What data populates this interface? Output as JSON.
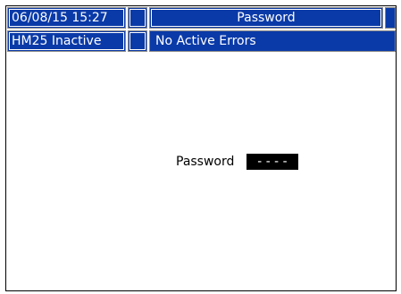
{
  "status_bar": {
    "datetime": "06/08/15 15:27",
    "screen_title": "Password",
    "system_status": "HM25 Inactive",
    "error_status": "No Active Errors"
  },
  "password_screen": {
    "label": "Password",
    "value": "----"
  },
  "colors": {
    "header_blue": "#0a3aa8",
    "title_frame": "#8a8a8a"
  }
}
